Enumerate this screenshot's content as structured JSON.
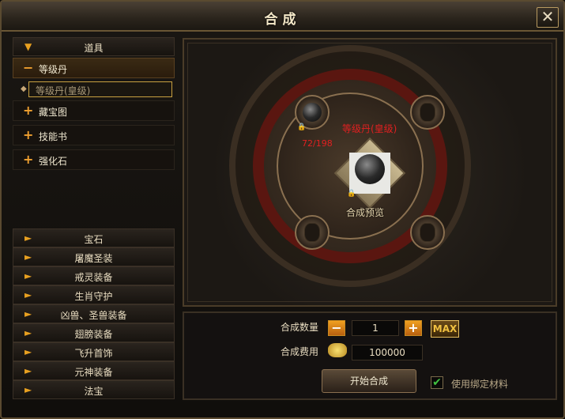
{
  "window": {
    "title": "合成",
    "close_label": "✕"
  },
  "sidebar": {
    "top_header": "道具",
    "categories": [
      {
        "label": "等级丹",
        "sign": "−",
        "open": true
      },
      {
        "label": "藏宝图",
        "sign": "+"
      },
      {
        "label": "技能书",
        "sign": "+"
      },
      {
        "label": "强化石",
        "sign": "+"
      }
    ],
    "selected_sub": "等级丹(皇级)",
    "bottom_items": [
      "宝石",
      "屠魔圣装",
      "戒灵装备",
      "生肖守护",
      "凶兽、圣兽装备",
      "翅膀装备",
      "飞升首饰",
      "元神装备",
      "法宝"
    ]
  },
  "synthesis": {
    "material_count": "72/198",
    "target_name": "等级丹(皇级)",
    "preview_label": "合成预览"
  },
  "controls": {
    "quantity_label": "合成数量",
    "quantity_value": "1",
    "minus": "−",
    "plus": "+",
    "max_label": "MAX",
    "cost_label": "合成费用",
    "cost_value": "100000",
    "start_button": "开始合成",
    "bind_checkbox_label": "使用绑定材料",
    "bind_checked": true
  }
}
